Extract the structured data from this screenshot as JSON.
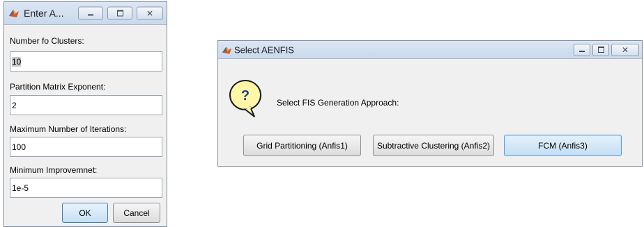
{
  "dialog_input": {
    "title": "Enter A...",
    "fields": [
      {
        "label": "Number fo Clusters:",
        "value": "10"
      },
      {
        "label": "Partition Matrix Exponent:",
        "value": "2"
      },
      {
        "label": "Maximum Number of Iterations:",
        "value": "100"
      },
      {
        "label": "Minimum Improvemnet:",
        "value": "1e-5"
      }
    ],
    "ok_label": "OK",
    "cancel_label": "Cancel"
  },
  "dialog_select": {
    "title": "Select AENFIS",
    "prompt": "Select FIS Generation Approach:",
    "question_mark": "?",
    "buttons": [
      {
        "label": "Grid Partitioning (Anfis1)"
      },
      {
        "label": "Subtractive Clustering (Anfis2)"
      },
      {
        "label": "FCM (Anfis3)"
      }
    ]
  },
  "window_controls": {
    "close_glyph": "✕"
  },
  "colors": {
    "titlebar": "#c9d9ec",
    "window_bg": "#f0f0f0",
    "focused_button": "#c4def3",
    "question_bubble": "#fff7a8"
  }
}
